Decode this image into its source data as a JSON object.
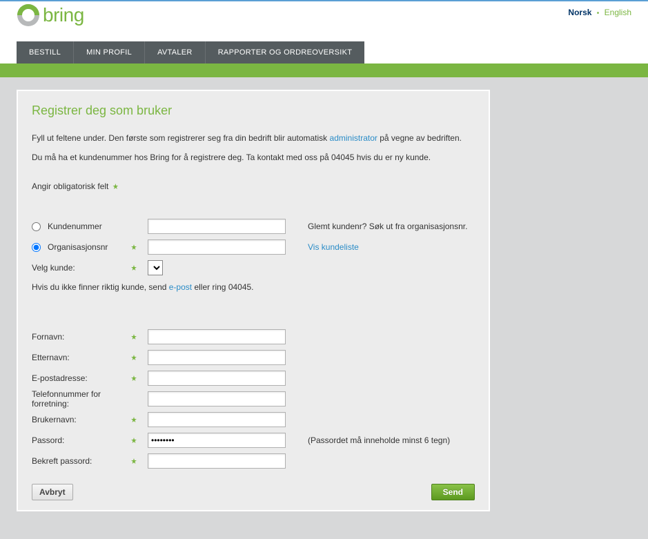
{
  "lang": {
    "active": "Norsk",
    "other": "English"
  },
  "logo_text": "bring",
  "nav": [
    "BESTILL",
    "MIN PROFIL",
    "AVTALER",
    "RAPPORTER OG ORDREOVERSIKT"
  ],
  "title": "Registrer deg som bruker",
  "intro1_a": "Fyll ut feltene under. Den første som registrerer seg fra din bedrift blir automatisk ",
  "intro1_link": "administrator",
  "intro1_b": " på vegne av bedriften.",
  "intro2": "Du må ha et kundenummer hos Bring for å registrere deg. Ta kontakt med oss på 04045 hvis du er ny kunde.",
  "mandatory": "Angir obligatorisk felt",
  "opt_customer": "Kundenummer",
  "opt_org": "Organisasjonsnr",
  "forgot_customer": "Glemt kundenr? Søk ut fra organisasjonsnr.",
  "show_custlist": "Vis kundeliste",
  "select_customer": "Velg kunde:",
  "helpline_a": "Hvis du ikke finner riktig kunde, send ",
  "helpline_link": "e-post",
  "helpline_b": " eller ring 04045.",
  "fields": {
    "first": "Fornavn:",
    "last": "Etternavn:",
    "email": "E-postadresse:",
    "phone": "Telefonnummer for forretning:",
    "user": "Brukernavn:",
    "pass": "Passord:",
    "pass_hint": "(Passordet må inneholde minst 6 tegn)",
    "pass_value": "••••••••",
    "pass2": "Bekreft passord:"
  },
  "btn_cancel": "Avbryt",
  "btn_send": "Send"
}
